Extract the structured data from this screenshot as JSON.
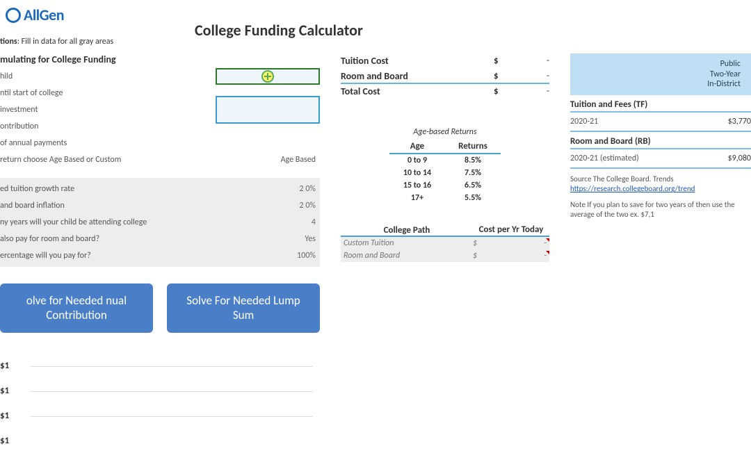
{
  "brand": "AllGen",
  "title": "College Funding Calculator",
  "instructions_label": "tions",
  "instructions_text": "Fill in data for all gray areas",
  "section_header": "mulating for College Funding",
  "inputs": {
    "child": "hild",
    "years_until": "ntil start of college",
    "investment": "investment",
    "contribution": "ontribution",
    "annual_payments": "of annual payments",
    "return_choice": "return  choose Age Based or Custom",
    "return_value": "Age Based"
  },
  "assumptions": {
    "tuition_growth_label": "ed tuition growth rate",
    "tuition_growth_value": "2 0%",
    "room_board_inflation_label": "and board inflation",
    "room_board_inflation_value": "2 0%",
    "years_attend_label": "ny years will your child be attending college",
    "years_attend_value": "4",
    "pay_room_board_label": "also pay for room and board?",
    "pay_room_board_value": "Yes",
    "percentage_label": "ercentage will you pay for?",
    "percentage_value": "100%"
  },
  "buttons": {
    "annual": "olve for Needed nual Contribution",
    "lump": "Solve For Needed Lump Sum"
  },
  "costs": {
    "tuition_label": "Tuition Cost",
    "room_label": "Room and Board",
    "total_label": "Total Cost",
    "currency": "$",
    "dash": "-"
  },
  "age_returns": {
    "title": "Age-based Returns",
    "col1": "Age",
    "col2": "Returns",
    "rows": [
      {
        "age": "0 to 9",
        "ret": "8.5%"
      },
      {
        "age": "10 to 14",
        "ret": "7.5%"
      },
      {
        "age": "15 to 16",
        "ret": "6.5%"
      },
      {
        "age": "17+",
        "ret": "5.5%"
      }
    ]
  },
  "college_path": {
    "col1": "College Path",
    "col2": "Cost per Yr Today",
    "rows": [
      {
        "label": "Custom Tuition",
        "cur": "$",
        "val": "-"
      },
      {
        "label": "Room and Board",
        "cur": "$",
        "val": "-"
      }
    ]
  },
  "sidebar": {
    "header_line1": "Public",
    "header_line2": "Two-Year",
    "header_line3": "In-District",
    "tf_title": "Tuition and Fees (TF)",
    "tf_year": "2020-21",
    "tf_value": "$3,770",
    "rb_title": "Room and Board (RB)",
    "rb_year": "2020-21 (estimated)",
    "rb_value": "$9,080",
    "source": "Source  The College Board. Trends",
    "link": "https://research.collegeboard.org/trend",
    "note": "Note  If you plan to save for two years of then use the average of the two ex. $7,1"
  },
  "chart_data": {
    "type": "bar",
    "ylabel": "$",
    "yticks": [
      "$1",
      "$1",
      "$1",
      "$1"
    ],
    "categories": [],
    "values": []
  }
}
